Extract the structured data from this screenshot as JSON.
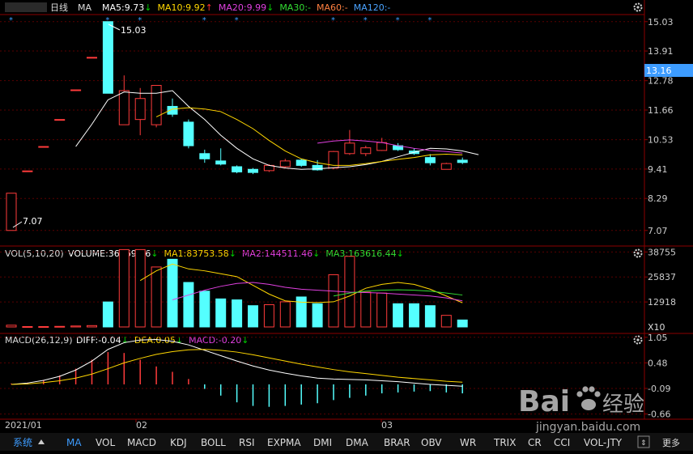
{
  "header": {
    "period": "日线",
    "ma_label": "MA",
    "ma_items": [
      {
        "text": "MA5:9.73",
        "arrow": "↓",
        "color": "#ffffff",
        "arrow_color": "#00cc00"
      },
      {
        "text": "MA10:9.92",
        "arrow": "↑",
        "color": "#ffd700",
        "arrow_color": "#ff3030"
      },
      {
        "text": "MA20:9.99",
        "arrow": "↓",
        "color": "#e040e0",
        "arrow_color": "#00cc00"
      },
      {
        "text": "MA30:-",
        "arrow": "",
        "color": "#33dd33",
        "arrow_color": ""
      },
      {
        "text": "MA60:-",
        "arrow": "",
        "color": "#ff8040",
        "arrow_color": ""
      },
      {
        "text": "MA120:-",
        "arrow": "",
        "color": "#4aa3ff",
        "arrow_color": ""
      }
    ]
  },
  "vol_header": {
    "label": "VOL(5,10,20)",
    "items": [
      {
        "text": "VOLUME:36069.56",
        "arrow": "↓",
        "color": "#ffffff",
        "arrow_color": "#00cc00"
      },
      {
        "text": "MA1:83753.58",
        "arrow": "↓",
        "color": "#ffd700",
        "arrow_color": "#00cc00"
      },
      {
        "text": "MA2:144511.46",
        "arrow": "↓",
        "color": "#e040e0",
        "arrow_color": "#00cc00"
      },
      {
        "text": "MA3:163616.44",
        "arrow": "↓",
        "color": "#33dd33",
        "arrow_color": "#00cc00"
      }
    ]
  },
  "macd_header": {
    "label": "MACD(26,12,9)",
    "items": [
      {
        "text": "DIFF:-0.04",
        "arrow": "↓",
        "color": "#ffffff",
        "arrow_color": "#00cc00"
      },
      {
        "text": "DEA:0.05",
        "arrow": "↓",
        "color": "#ffd700",
        "arrow_color": "#00cc00"
      },
      {
        "text": "MACD:-0.20",
        "arrow": "↓",
        "color": "#e040e0",
        "arrow_color": "#00cc00"
      }
    ]
  },
  "annotations": {
    "high_label": "15.03",
    "low_label": "7.07",
    "current_price": "13.16",
    "vol_unit": "X10"
  },
  "time_axis": [
    "2021/01",
    "02",
    "03"
  ],
  "bottom_tabs": {
    "menu_label": "系统",
    "tabs": [
      "MA",
      "VOL",
      "MACD",
      "KDJ",
      "BOLL",
      "RSI",
      "EXPMA",
      "DMI",
      "DMA",
      "BRAR",
      "OBV",
      "WR",
      "TRIX",
      "CR",
      "CCI",
      "VOL-JTY"
    ],
    "active": "MA",
    "jump_label": "更多"
  },
  "watermark": {
    "brand": "Bai",
    "brand2": "经验",
    "url": "jingyan.baidu.com"
  },
  "colors": {
    "up": "#ff3b3b",
    "down": "#54ffff",
    "grid": "#8b0000",
    "axis_text": "#cccccc"
  },
  "chart_data": [
    {
      "type": "candlestick",
      "title": "日线",
      "ylim": [
        6.6,
        15.3
      ],
      "yticks": [
        15.03,
        13.91,
        12.78,
        11.66,
        10.53,
        9.41,
        8.29,
        7.07
      ],
      "candles": [
        {
          "o": 7.07,
          "h": 8.49,
          "l": 7.07,
          "c": 8.49
        },
        {
          "o": 9.34,
          "h": 9.34,
          "l": 9.34,
          "c": 9.34
        },
        {
          "o": 10.27,
          "h": 10.27,
          "l": 10.27,
          "c": 10.27
        },
        {
          "o": 11.3,
          "h": 11.3,
          "l": 11.3,
          "c": 11.3
        },
        {
          "o": 12.43,
          "h": 12.43,
          "l": 12.43,
          "c": 12.43
        },
        {
          "o": 13.67,
          "h": 13.67,
          "l": 13.67,
          "c": 13.67
        },
        {
          "o": 15.03,
          "h": 15.03,
          "l": 12.3,
          "c": 12.3
        },
        {
          "o": 11.1,
          "h": 12.98,
          "l": 11.1,
          "c": 12.4
        },
        {
          "o": 11.3,
          "h": 12.5,
          "l": 10.7,
          "c": 12.1
        },
        {
          "o": 11.1,
          "h": 12.6,
          "l": 11.0,
          "c": 12.6
        },
        {
          "o": 11.8,
          "h": 12.1,
          "l": 11.4,
          "c": 11.5
        },
        {
          "o": 11.2,
          "h": 11.3,
          "l": 10.2,
          "c": 10.3
        },
        {
          "o": 10.0,
          "h": 10.15,
          "l": 9.65,
          "c": 9.8
        },
        {
          "o": 9.72,
          "h": 10.2,
          "l": 9.55,
          "c": 9.6
        },
        {
          "o": 9.5,
          "h": 9.55,
          "l": 9.25,
          "c": 9.3
        },
        {
          "o": 9.4,
          "h": 9.45,
          "l": 9.22,
          "c": 9.28
        },
        {
          "o": 9.35,
          "h": 9.6,
          "l": 9.3,
          "c": 9.55
        },
        {
          "o": 9.5,
          "h": 9.8,
          "l": 9.45,
          "c": 9.72
        },
        {
          "o": 9.75,
          "h": 9.8,
          "l": 9.5,
          "c": 9.55
        },
        {
          "o": 9.55,
          "h": 9.75,
          "l": 9.35,
          "c": 9.38
        },
        {
          "o": 9.45,
          "h": 10.1,
          "l": 9.4,
          "c": 10.08
        },
        {
          "o": 10.0,
          "h": 10.9,
          "l": 9.95,
          "c": 10.4
        },
        {
          "o": 10.0,
          "h": 10.3,
          "l": 9.9,
          "c": 10.22
        },
        {
          "o": 10.12,
          "h": 10.6,
          "l": 10.1,
          "c": 10.42
        },
        {
          "o": 10.3,
          "h": 10.4,
          "l": 10.1,
          "c": 10.15
        },
        {
          "o": 10.1,
          "h": 10.2,
          "l": 9.95,
          "c": 10.0
        },
        {
          "o": 9.85,
          "h": 9.98,
          "l": 9.55,
          "c": 9.65
        },
        {
          "o": 9.4,
          "h": 9.65,
          "l": 9.4,
          "c": 9.62
        },
        {
          "o": 9.75,
          "h": 9.85,
          "l": 9.6,
          "c": 9.66
        }
      ],
      "series": [
        {
          "name": "MA5",
          "color": "#ffffff",
          "start": 4,
          "values": [
            10.27,
            11.12,
            12.05,
            12.35,
            12.3,
            12.3,
            12.4,
            11.8,
            11.3,
            10.7,
            10.2,
            9.8,
            9.55,
            9.45,
            9.4,
            9.42,
            9.46,
            9.5,
            9.58,
            9.7,
            9.88,
            10.05,
            10.2,
            10.18,
            10.1,
            9.96
          ]
        },
        {
          "name": "MA10",
          "color": "#ffd700",
          "start": 9,
          "values": [
            11.4,
            11.7,
            11.75,
            11.7,
            11.6,
            11.3,
            10.95,
            10.5,
            10.1,
            9.8,
            9.65,
            9.55,
            9.55,
            9.62,
            9.7,
            9.78,
            9.85,
            9.95,
            9.98,
            9.95
          ]
        },
        {
          "name": "MA20",
          "color": "#e040e0",
          "start": 19,
          "values": [
            10.4,
            10.48,
            10.52,
            10.48,
            10.42,
            10.3,
            10.2,
            10.12,
            10.08,
            10.02
          ]
        }
      ]
    },
    {
      "type": "bar",
      "title": "VOL(5,10,20)",
      "ylim": [
        0,
        41000
      ],
      "yticks": [
        38755,
        25837,
        12918
      ],
      "volumes": [
        {
          "v": 900,
          "up": true
        },
        {
          "v": 200,
          "up": true
        },
        {
          "v": 200,
          "up": true
        },
        {
          "v": 300,
          "up": true
        },
        {
          "v": 500,
          "up": true
        },
        {
          "v": 700,
          "up": true
        },
        {
          "v": 12918,
          "up": false
        },
        {
          "v": 40000,
          "up": true
        },
        {
          "v": 40000,
          "up": true
        },
        {
          "v": 31000,
          "up": true
        },
        {
          "v": 35000,
          "up": false
        },
        {
          "v": 23000,
          "up": false
        },
        {
          "v": 18500,
          "up": false
        },
        {
          "v": 14500,
          "up": false
        },
        {
          "v": 14000,
          "up": false
        },
        {
          "v": 11000,
          "up": false
        },
        {
          "v": 11500,
          "up": true
        },
        {
          "v": 13000,
          "up": true
        },
        {
          "v": 15500,
          "up": false
        },
        {
          "v": 12000,
          "up": false
        },
        {
          "v": 27000,
          "up": true
        },
        {
          "v": 36500,
          "up": true
        },
        {
          "v": 18000,
          "up": true
        },
        {
          "v": 17500,
          "up": true
        },
        {
          "v": 12000,
          "up": false
        },
        {
          "v": 12000,
          "up": false
        },
        {
          "v": 11000,
          "up": false
        },
        {
          "v": 6000,
          "up": true
        },
        {
          "v": 3600,
          "up": false
        }
      ],
      "series": [
        {
          "name": "MA1",
          "color": "#ffd700",
          "start": 8,
          "values": [
            24000,
            29000,
            32500,
            30000,
            29000,
            27500,
            26000,
            21500,
            17000,
            13500,
            12800,
            12600,
            13000,
            16000,
            20000,
            22000,
            23000,
            22000,
            19500,
            16000,
            12500
          ]
        },
        {
          "name": "MA2",
          "color": "#e040e0",
          "start": 10,
          "values": [
            14000,
            16500,
            19000,
            21000,
            22500,
            23000,
            22000,
            20500,
            19500,
            19000,
            18500,
            18000,
            17800,
            17500,
            17000,
            16500,
            16000,
            15000,
            13500
          ]
        },
        {
          "name": "MA3",
          "color": "#33dd33",
          "start": 20,
          "values": [
            16000,
            17500,
            18500,
            19000,
            19200,
            19000,
            18500,
            17500,
            16500
          ]
        }
      ]
    },
    {
      "type": "bar",
      "title": "MACD(26,12,9)",
      "ylim": [
        -0.74,
        1.1
      ],
      "yticks": [
        1.05,
        0.48,
        -0.09,
        -0.66
      ],
      "macd": [
        0.02,
        0.04,
        0.1,
        0.2,
        0.35,
        0.55,
        0.72,
        0.7,
        0.55,
        0.4,
        0.28,
        0.12,
        -0.1,
        -0.25,
        -0.4,
        -0.48,
        -0.5,
        -0.48,
        -0.45,
        -0.42,
        -0.35,
        -0.3,
        -0.25,
        -0.2,
        -0.18,
        -0.16,
        -0.15,
        -0.18,
        -0.2
      ],
      "series": [
        {
          "name": "DIFF",
          "color": "#ffffff",
          "values": [
            0.0,
            0.03,
            0.09,
            0.18,
            0.32,
            0.52,
            0.78,
            0.93,
            0.99,
            1.0,
            0.96,
            0.88,
            0.76,
            0.64,
            0.52,
            0.41,
            0.32,
            0.25,
            0.19,
            0.14,
            0.12,
            0.11,
            0.1,
            0.08,
            0.06,
            0.03,
            0.0,
            -0.02,
            -0.04
          ]
        },
        {
          "name": "DEA",
          "color": "#ffd700",
          "values": [
            0.0,
            0.01,
            0.04,
            0.08,
            0.14,
            0.23,
            0.35,
            0.48,
            0.58,
            0.67,
            0.73,
            0.77,
            0.78,
            0.76,
            0.72,
            0.66,
            0.59,
            0.52,
            0.45,
            0.39,
            0.33,
            0.28,
            0.24,
            0.2,
            0.16,
            0.13,
            0.1,
            0.07,
            0.05
          ]
        }
      ]
    }
  ]
}
